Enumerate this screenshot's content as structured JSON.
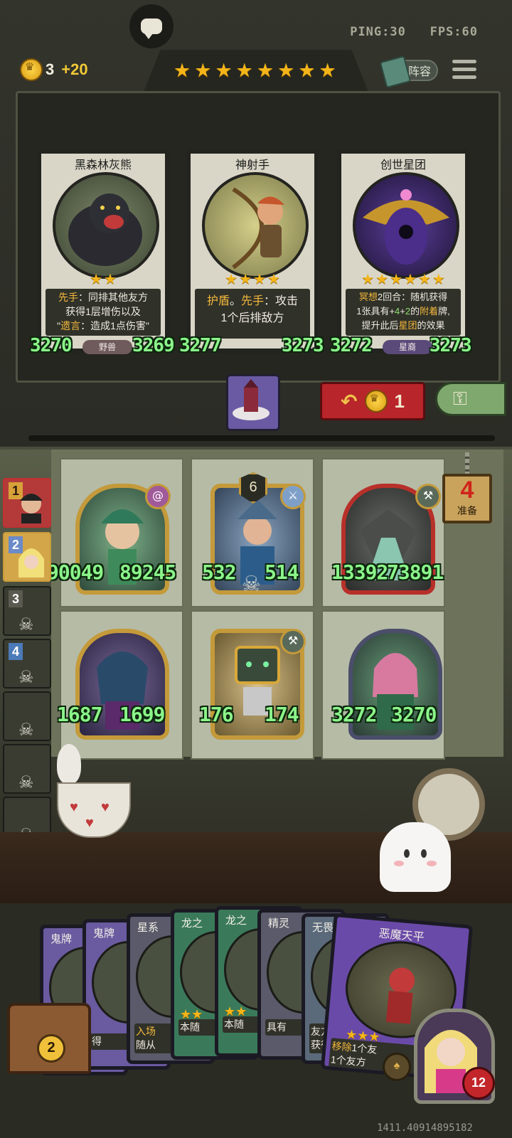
{
  "topbar": {
    "ping": "PING:30",
    "fps": "FPS:60",
    "gold": "3",
    "gold_income": "+20",
    "tavern_stars": 8,
    "lineup_label": "阵容"
  },
  "shop": {
    "cards": [
      {
        "name": "黑森林灰熊",
        "stars": 2,
        "desc_parts": [
          "先手",
          "：同排其他友方",
          "获得1层增伤以及",
          "\"",
          "遗言",
          "：造成1点伤害\""
        ],
        "tribe": "野兽",
        "attack": "3270",
        "health": "3269"
      },
      {
        "name": "神射手",
        "stars": 4,
        "desc_parts": [
          "护盾",
          "。",
          "先手",
          "：攻击",
          "1个后排敌方"
        ],
        "tribe": "",
        "attack": "3277",
        "health": "3273"
      },
      {
        "name": "创世星团",
        "stars": 6,
        "desc_parts": [
          "冥想",
          "2回合：随机获得",
          "1张具有+",
          "4",
          "+",
          "2",
          "的",
          "附着",
          "牌,",
          "提升此后",
          "星团",
          "的效果"
        ],
        "tribe": "星裔",
        "attack": "3272",
        "health": "3273"
      }
    ],
    "refresh_cost": "1"
  },
  "board": {
    "ready_count": "4",
    "ready_label": "准备",
    "minions": [
      {
        "attack": "90049",
        "health": "89245",
        "tier": ""
      },
      {
        "attack": "532",
        "health": "514",
        "tier": "6"
      },
      {
        "attack": "13392",
        "health": "73891",
        "tier": ""
      },
      {
        "attack": "1687",
        "health": "1699",
        "tier": ""
      },
      {
        "attack": "176",
        "health": "174",
        "tier": ""
      },
      {
        "attack": "3272",
        "health": "3270",
        "tier": ""
      }
    ]
  },
  "players": [
    {
      "rank": "1",
      "dead": false
    },
    {
      "rank": "2",
      "dead": false
    },
    {
      "rank": "3",
      "dead": true
    },
    {
      "rank": "4",
      "dead": true
    },
    {
      "rank": "",
      "dead": true
    },
    {
      "rank": "",
      "dead": true
    },
    {
      "rank": "",
      "dead": true
    },
    {
      "rank": "",
      "dead": true
    }
  ],
  "hand": {
    "cards": [
      {
        "name": "鬼牌",
        "text": ""
      },
      {
        "name": "鬼牌",
        "text": "得"
      },
      {
        "name": "星系",
        "text_a": "入场",
        "text_b": "随从"
      },
      {
        "name": "龙之",
        "text_a": "本随",
        "text_b": ""
      },
      {
        "name": "龙之",
        "text_a": "本随",
        "text_b": ""
      },
      {
        "name": "精灵",
        "text_a": "具有",
        "text_b": ""
      },
      {
        "name": "无畏",
        "text_a": "友方",
        "text_b": "获得"
      },
      {
        "name": "恶魔天平",
        "text_a": "移除",
        "text_a_rest": "1个友",
        "text_b": "1个友方"
      }
    ],
    "chest_count": "2",
    "hero_health": "12"
  },
  "session_id": "1411.40914895182",
  "colors": {
    "stat_green": "#8bf58a",
    "keyword_gold": "#f5b93c",
    "refresh_red": "#b8252a",
    "freeze_green": "#7ea86d"
  }
}
